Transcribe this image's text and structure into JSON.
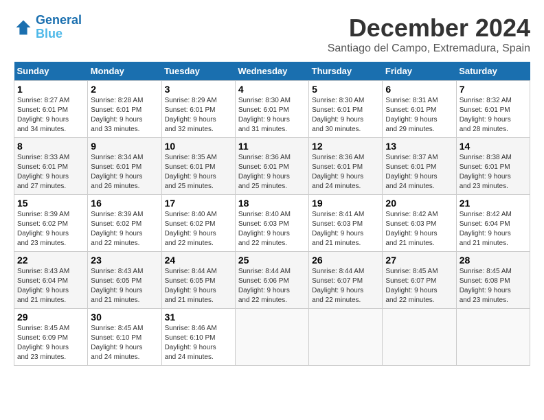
{
  "header": {
    "logo_line1": "General",
    "logo_line2": "Blue",
    "month": "December 2024",
    "location": "Santiago del Campo, Extremadura, Spain"
  },
  "weekdays": [
    "Sunday",
    "Monday",
    "Tuesday",
    "Wednesday",
    "Thursday",
    "Friday",
    "Saturday"
  ],
  "weeks": [
    [
      {
        "day": 1,
        "sunrise": "8:27 AM",
        "sunset": "6:01 PM",
        "daylight": "9 hours and 34 minutes."
      },
      {
        "day": 2,
        "sunrise": "8:28 AM",
        "sunset": "6:01 PM",
        "daylight": "9 hours and 33 minutes."
      },
      {
        "day": 3,
        "sunrise": "8:29 AM",
        "sunset": "6:01 PM",
        "daylight": "9 hours and 32 minutes."
      },
      {
        "day": 4,
        "sunrise": "8:30 AM",
        "sunset": "6:01 PM",
        "daylight": "9 hours and 31 minutes."
      },
      {
        "day": 5,
        "sunrise": "8:30 AM",
        "sunset": "6:01 PM",
        "daylight": "9 hours and 30 minutes."
      },
      {
        "day": 6,
        "sunrise": "8:31 AM",
        "sunset": "6:01 PM",
        "daylight": "9 hours and 29 minutes."
      },
      {
        "day": 7,
        "sunrise": "8:32 AM",
        "sunset": "6:01 PM",
        "daylight": "9 hours and 28 minutes."
      }
    ],
    [
      {
        "day": 8,
        "sunrise": "8:33 AM",
        "sunset": "6:01 PM",
        "daylight": "9 hours and 27 minutes."
      },
      {
        "day": 9,
        "sunrise": "8:34 AM",
        "sunset": "6:01 PM",
        "daylight": "9 hours and 26 minutes."
      },
      {
        "day": 10,
        "sunrise": "8:35 AM",
        "sunset": "6:01 PM",
        "daylight": "9 hours and 25 minutes."
      },
      {
        "day": 11,
        "sunrise": "8:36 AM",
        "sunset": "6:01 PM",
        "daylight": "9 hours and 25 minutes."
      },
      {
        "day": 12,
        "sunrise": "8:36 AM",
        "sunset": "6:01 PM",
        "daylight": "9 hours and 24 minutes."
      },
      {
        "day": 13,
        "sunrise": "8:37 AM",
        "sunset": "6:01 PM",
        "daylight": "9 hours and 24 minutes."
      },
      {
        "day": 14,
        "sunrise": "8:38 AM",
        "sunset": "6:01 PM",
        "daylight": "9 hours and 23 minutes."
      }
    ],
    [
      {
        "day": 15,
        "sunrise": "8:39 AM",
        "sunset": "6:02 PM",
        "daylight": "9 hours and 23 minutes."
      },
      {
        "day": 16,
        "sunrise": "8:39 AM",
        "sunset": "6:02 PM",
        "daylight": "9 hours and 22 minutes."
      },
      {
        "day": 17,
        "sunrise": "8:40 AM",
        "sunset": "6:02 PM",
        "daylight": "9 hours and 22 minutes."
      },
      {
        "day": 18,
        "sunrise": "8:40 AM",
        "sunset": "6:03 PM",
        "daylight": "9 hours and 22 minutes."
      },
      {
        "day": 19,
        "sunrise": "8:41 AM",
        "sunset": "6:03 PM",
        "daylight": "9 hours and 21 minutes."
      },
      {
        "day": 20,
        "sunrise": "8:42 AM",
        "sunset": "6:03 PM",
        "daylight": "9 hours and 21 minutes."
      },
      {
        "day": 21,
        "sunrise": "8:42 AM",
        "sunset": "6:04 PM",
        "daylight": "9 hours and 21 minutes."
      }
    ],
    [
      {
        "day": 22,
        "sunrise": "8:43 AM",
        "sunset": "6:04 PM",
        "daylight": "9 hours and 21 minutes."
      },
      {
        "day": 23,
        "sunrise": "8:43 AM",
        "sunset": "6:05 PM",
        "daylight": "9 hours and 21 minutes."
      },
      {
        "day": 24,
        "sunrise": "8:44 AM",
        "sunset": "6:05 PM",
        "daylight": "9 hours and 21 minutes."
      },
      {
        "day": 25,
        "sunrise": "8:44 AM",
        "sunset": "6:06 PM",
        "daylight": "9 hours and 22 minutes."
      },
      {
        "day": 26,
        "sunrise": "8:44 AM",
        "sunset": "6:07 PM",
        "daylight": "9 hours and 22 minutes."
      },
      {
        "day": 27,
        "sunrise": "8:45 AM",
        "sunset": "6:07 PM",
        "daylight": "9 hours and 22 minutes."
      },
      {
        "day": 28,
        "sunrise": "8:45 AM",
        "sunset": "6:08 PM",
        "daylight": "9 hours and 23 minutes."
      }
    ],
    [
      {
        "day": 29,
        "sunrise": "8:45 AM",
        "sunset": "6:09 PM",
        "daylight": "9 hours and 23 minutes."
      },
      {
        "day": 30,
        "sunrise": "8:45 AM",
        "sunset": "6:10 PM",
        "daylight": "9 hours and 24 minutes."
      },
      {
        "day": 31,
        "sunrise": "8:46 AM",
        "sunset": "6:10 PM",
        "daylight": "9 hours and 24 minutes."
      },
      null,
      null,
      null,
      null
    ]
  ]
}
